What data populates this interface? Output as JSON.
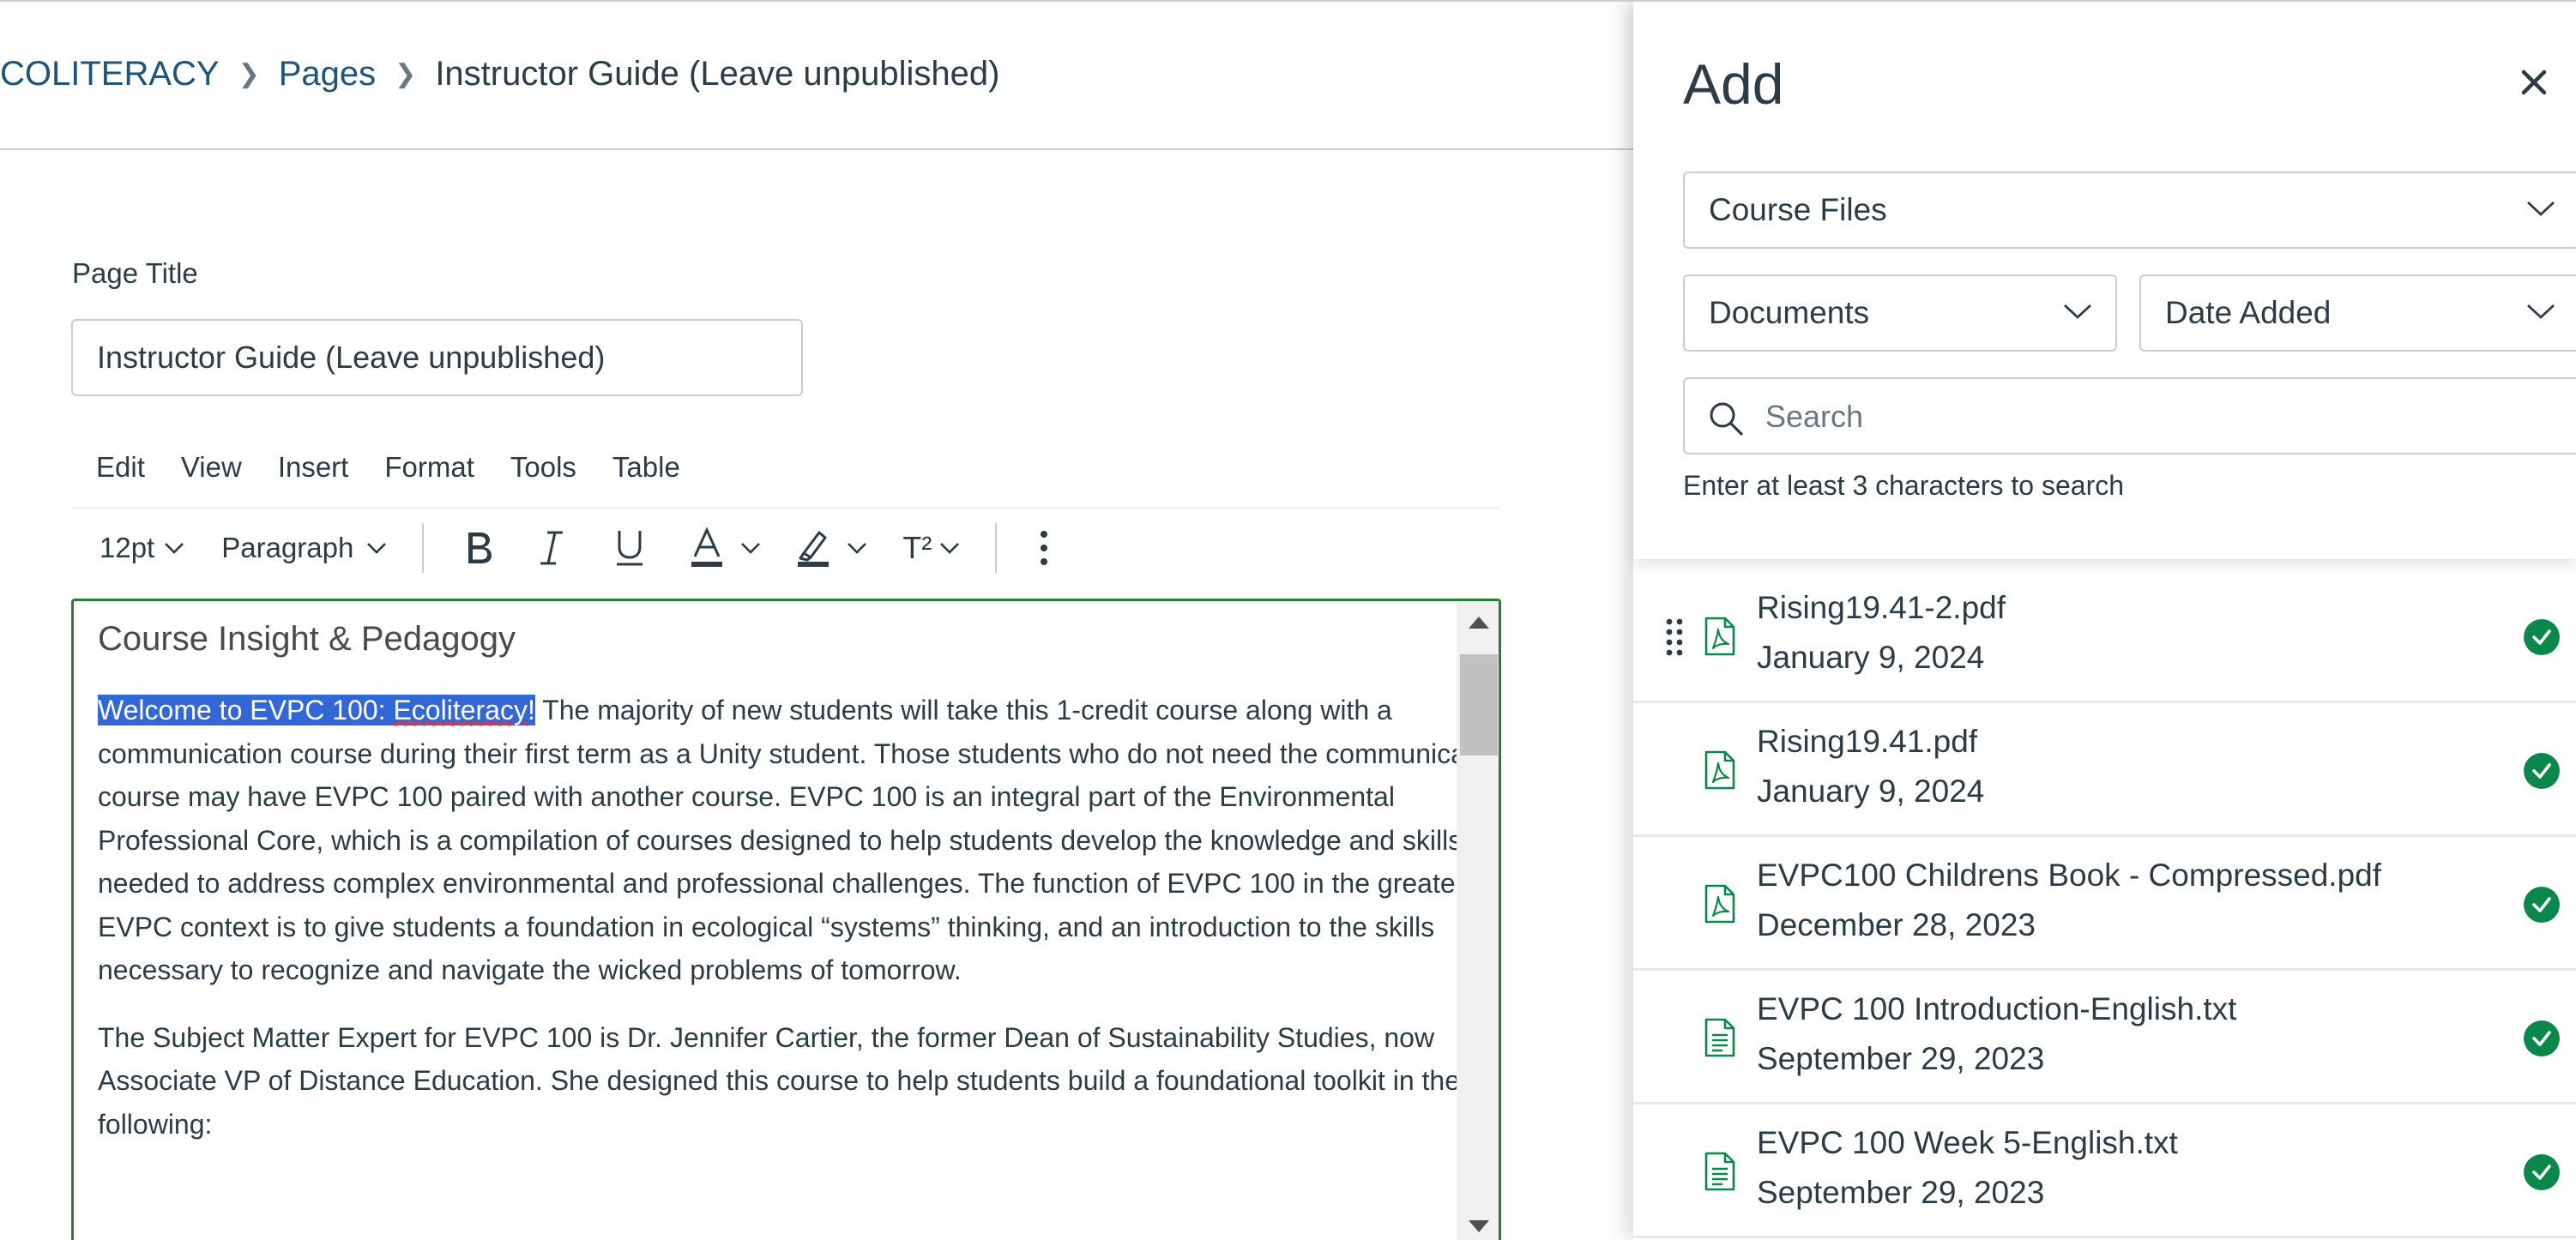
{
  "breadcrumb": {
    "course": "COLITERACY",
    "section": "Pages",
    "current": "Instructor Guide (Leave unpublished)"
  },
  "page_title_field": {
    "label": "Page Title",
    "value": "Instructor Guide (Leave unpublished)"
  },
  "editor_menu": [
    "Edit",
    "View",
    "Insert",
    "Format",
    "Tools",
    "Table"
  ],
  "toolbar": {
    "font_size": "12pt",
    "block_format": "Paragraph",
    "superscript_label": "T²"
  },
  "editor_content": {
    "heading": "Course Insight & Pedagogy",
    "highlight_prefix": "Welcome to EVPC 100: ",
    "highlight_misspelled": "Ecoliteracy",
    "highlight_suffix": "!",
    "paragraph1_rest": " The majority of new students will take this 1-credit course along with a communication course during their first term as a Unity student. Those students who do not need the communication course may have EVPC 100 paired with another course. EVPC 100 is an integral part of the Environmental Professional Core, which is a compilation of courses designed to help students develop the knowledge and skills needed to address complex environmental and professional challenges. The function of EVPC 100 in the greater EVPC context is to give students a foundation in ecological “systems” thinking, and an introduction to the skills necessary to recognize and navigate the wicked problems of tomorrow.",
    "paragraph2": "The Subject Matter Expert for EVPC 100 is Dr. Jennifer Cartier, the former Dean of Sustainability Studies, now Associate VP of Distance Education. She designed this course to help students build a foundational toolkit in the following:"
  },
  "tray": {
    "title": "Add",
    "content_source": "Course Files",
    "content_type": "Documents",
    "sort_by": "Date Added",
    "search_placeholder": "Search",
    "search_hint": "Enter at least 3 characters to search",
    "files": [
      {
        "name": "Rising19.41-2.pdf",
        "date": "January 9, 2024",
        "icon": "pdf-icon"
      },
      {
        "name": "Rising19.41.pdf",
        "date": "January 9, 2024",
        "icon": "pdf-icon"
      },
      {
        "name": "EVPC100 Childrens Book - Compressed.pdf",
        "date": "December 28, 2023",
        "icon": "pdf-icon"
      },
      {
        "name": "EVPC 100 Introduction-English.txt",
        "date": "September 29, 2023",
        "icon": "text-document-icon"
      },
      {
        "name": "EVPC 100 Week 5-English.txt",
        "date": "September 29, 2023",
        "icon": "text-document-icon"
      }
    ]
  },
  "colors": {
    "link": "#1f5377",
    "text": "#2d3b45",
    "editor_focus_border": "#2a7d36",
    "selection": "#3367d6",
    "file_icon": "#0b874b",
    "published_check": "#0b874b"
  }
}
